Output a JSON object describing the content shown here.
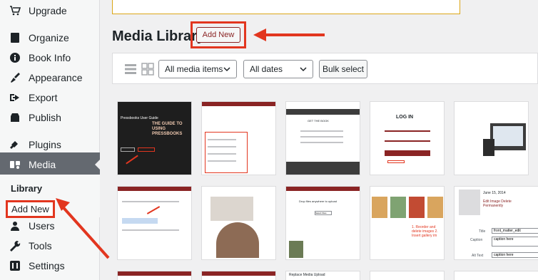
{
  "sidebar": {
    "items": [
      {
        "label": "Upgrade",
        "icon": "cart-icon"
      },
      {
        "label": "Organize",
        "icon": "book-icon"
      },
      {
        "label": "Book Info",
        "icon": "info-icon"
      },
      {
        "label": "Appearance",
        "icon": "brush-icon"
      },
      {
        "label": "Export",
        "icon": "export-icon"
      },
      {
        "label": "Publish",
        "icon": "store-icon"
      },
      {
        "label": "Plugins",
        "icon": "plugin-icon"
      },
      {
        "label": "Media",
        "icon": "media-icon"
      },
      {
        "label": "Users",
        "icon": "user-icon"
      },
      {
        "label": "Tools",
        "icon": "wrench-icon"
      },
      {
        "label": "Settings",
        "icon": "settings-icon"
      }
    ],
    "submenu": {
      "library": "Library",
      "add_new": "Add New"
    }
  },
  "main": {
    "title": "Media Library",
    "add_new": "Add New",
    "toolbar": {
      "media_filter": "All media items",
      "date_filter": "All dates",
      "bulk_select": "Bulk select"
    }
  },
  "tiles": [
    {
      "title": "Pressbooks User Guide",
      "caption": "THE GUIDE TO USING PRESSBOOKS"
    },
    {
      "title": "",
      "caption": ""
    },
    {
      "title": "GET THE BOOK",
      "caption": ""
    },
    {
      "title": "LOG IN",
      "caption": ""
    },
    {
      "title": "",
      "caption": ""
    },
    {
      "title": "",
      "caption": ""
    },
    {
      "title": "",
      "caption": ""
    },
    {
      "title": "Drop files anywhere to upload",
      "caption": "Select Files"
    },
    {
      "title": "",
      "caption": "1. Reorder and delete images  2. Insert gallery im"
    },
    {
      "title": "June 15, 2014",
      "caption": "Edit Image  Delete Permanently"
    }
  ],
  "details": {
    "title_label": "Title",
    "title_value": "front_matter_edit",
    "caption_label": "Caption",
    "caption_value": "caption here",
    "alt_label": "Alt Text",
    "alt_value": "caption here"
  },
  "bottom": {
    "replace": "Replace Media Upload"
  },
  "colors": {
    "accent": "#8a2424",
    "highlight": "#e2361f",
    "active_menu": "#646970"
  }
}
